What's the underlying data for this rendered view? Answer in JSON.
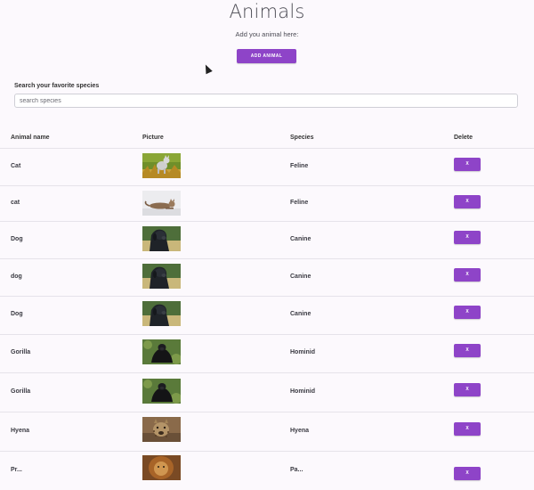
{
  "header": {
    "title": "Animals",
    "subtitle": "Add you animal here:",
    "add_button_label": "ADD ANIMAL"
  },
  "search": {
    "label": "Search your favorite species",
    "placeholder": "search species",
    "value": ""
  },
  "table": {
    "columns": [
      "Animal name",
      "Picture",
      "Species",
      "Delete"
    ],
    "rows": [
      {
        "name": "Cat",
        "picture": "cat-photo",
        "species": "Feline",
        "delete_label": "X"
      },
      {
        "name": "cat",
        "picture": "cat-lying-photo",
        "species": "Feline",
        "delete_label": "X"
      },
      {
        "name": "Dog",
        "picture": "dog-photo",
        "species": "Canine",
        "delete_label": "X"
      },
      {
        "name": "dog",
        "picture": "dog-photo",
        "species": "Canine",
        "delete_label": "X"
      },
      {
        "name": "Dog",
        "picture": "dog-photo",
        "species": "Canine",
        "delete_label": "X"
      },
      {
        "name": "Gorilla",
        "picture": "gorilla-photo",
        "species": "Hominid",
        "delete_label": "X"
      },
      {
        "name": "Gorilla",
        "picture": "gorilla-photo",
        "species": "Hominid",
        "delete_label": "X"
      },
      {
        "name": "Hyena",
        "picture": "hyena-photo",
        "species": "Hyena",
        "delete_label": "X"
      },
      {
        "name": "Pr...",
        "picture": "lion-photo",
        "species": "Pa...",
        "delete_label": "X"
      }
    ]
  },
  "colors": {
    "accent": "#8e44c8",
    "background": "#fcf9fd"
  }
}
